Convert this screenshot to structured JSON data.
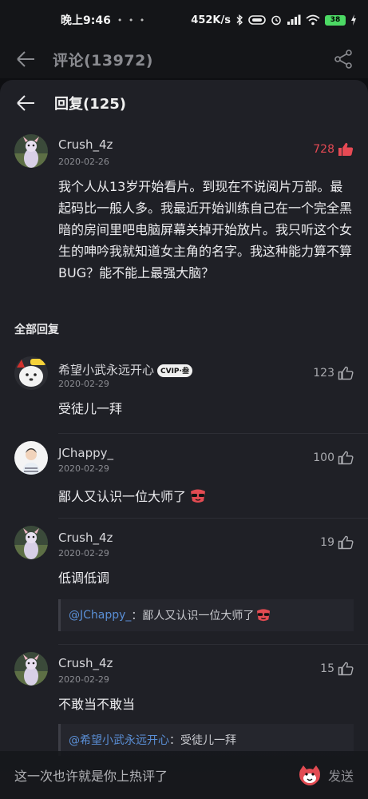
{
  "status_bar": {
    "time": "晚上9:46",
    "dots": "• • •",
    "speed": "452K/s",
    "battery": "38"
  },
  "header": {
    "title": "评论(13972)"
  },
  "reply_panel": {
    "title": "回复(125)",
    "main_comment": {
      "username": "Crush_4z",
      "date": "2020-02-26",
      "likes": "728",
      "text": "我个人从13岁开始看片。到现在不说阅片万部。最起码比一般人多。我最近开始训练自己在一个完全黑暗的房间里吧电脑屏幕关掉开始放片。我只听这个女生的呻吟我就知道女主角的名字。我这种能力算不算BUG？能不能上最强大脑？"
    },
    "section_title": "全部回复",
    "replies": [
      {
        "username": "希望小武永远开心",
        "badge": "CVIP·叁",
        "date": "2020-02-29",
        "likes": "123",
        "text": "受徒儿一拜"
      },
      {
        "username": "JChappy_",
        "date": "2020-02-29",
        "likes": "100",
        "text": "鄙人又认识一位大师了"
      },
      {
        "username": "Crush_4z",
        "date": "2020-02-29",
        "likes": "19",
        "text": "低调低调",
        "quote_user": "@JChappy_",
        "quote_text": "：鄙人又认识一位大师了"
      },
      {
        "username": "Crush_4z",
        "date": "2020-02-29",
        "likes": "15",
        "text": "不敢当不敢当",
        "quote_user": "@希望小武永远开心",
        "quote_text": "：受徒儿一拜"
      }
    ]
  },
  "input_bar": {
    "placeholder": "这一次也许就是你上热评了",
    "send_label": "发送"
  },
  "colors": {
    "accent_red": "#e64a54",
    "link_blue": "#5a8fd6",
    "panel_bg": "#1f2026"
  }
}
